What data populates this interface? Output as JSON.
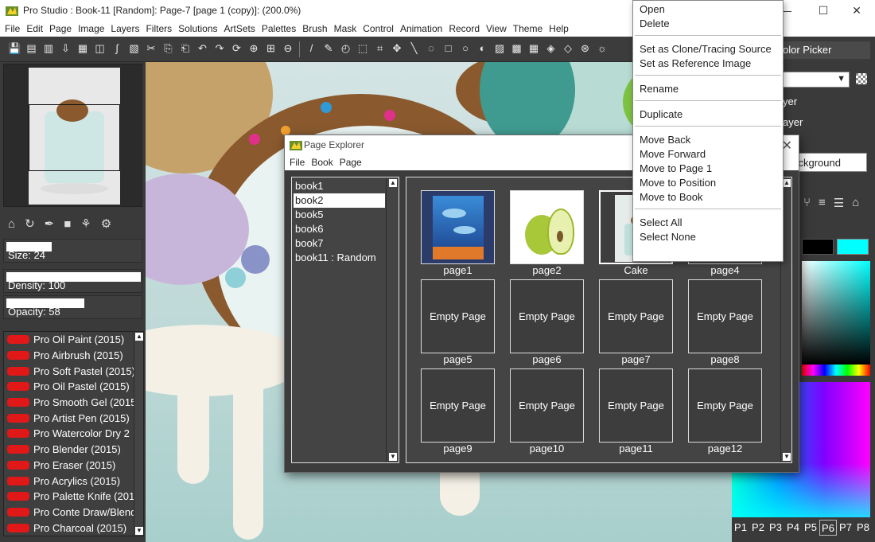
{
  "window": {
    "title": "Pro Studio : Book-11 [Random]: Page-7 [page 1 (copy)]: (200.0%)",
    "minimize": "—",
    "maximize": "☐",
    "close": "✕"
  },
  "menubar": [
    "File",
    "Edit",
    "Page",
    "Image",
    "Layers",
    "Filters",
    "Solutions",
    "ArtSets",
    "Palettes",
    "Brush",
    "Mask",
    "Control",
    "Animation",
    "Record",
    "View",
    "Theme",
    "Help"
  ],
  "toolbar": {
    "icons": [
      "save-icon",
      "save-as-icon",
      "export-icon",
      "import-icon",
      "new-page-icon",
      "gel-icon",
      "wand-icon",
      "clipboard-icon",
      "scissors-icon",
      "copy-icon",
      "paste-icon",
      "undo-icon",
      "redo-icon",
      "rotate-icon",
      "zoom-in-icon",
      "fit-icon",
      "zoom-out-icon",
      "brush-tool-icon",
      "eyedropper-icon",
      "bucket-icon",
      "select-rect-icon",
      "crop-icon",
      "move-icon",
      "line-icon",
      "lasso-icon",
      "rect-shape-icon",
      "ellipse-shape-icon",
      "blend-icon",
      "gradient-icon",
      "pattern-icon",
      "texture-icon",
      "mesh-icon",
      "emboss-icon",
      "clone-icon",
      "smudge-icon"
    ]
  },
  "left_panel": {
    "brush_tools": [
      "stamp-icon",
      "refresh-icon",
      "pen-tool-icon",
      "square-tool-icon",
      "layers-tool-icon",
      "settings-icon"
    ],
    "size_label": "Size: 24",
    "size_level": 0.34,
    "density_label": "Density: 100",
    "density_level": 1.0,
    "opacity_label": "Opacity: 58",
    "opacity_level": 0.58,
    "brushes": [
      "Pro Oil Paint (2015)",
      "Pro Airbrush (2015)",
      "Pro Soft Pastel (2015)",
      "Pro Oil Pastel (2015)",
      "Pro Smooth Gel (2015",
      "Pro Artist Pen (2015)",
      "Pro Watercolor Dry 2",
      "Pro Blender (2015)",
      "Pro Eraser (2015)",
      "Pro Acrylics (2015)",
      "Pro Palette Knife (201",
      "Pro Conte Draw/Blend",
      "Pro Charcoal (2015)"
    ]
  },
  "right_panel": {
    "color_picker_title": "olor Picker",
    "layer_rows": [
      "yer",
      "ayer",
      "yer"
    ],
    "layer_name_input": "background",
    "secondary_color": "#000000",
    "primary_color": "#00ffff",
    "palette_tabs": [
      "P1",
      "P2",
      "P3",
      "P4",
      "P5",
      "P6",
      "P7",
      "P8"
    ],
    "active_palette_tab": "P6"
  },
  "page_explorer": {
    "title": "Page Explorer",
    "menu": [
      "File",
      "Book",
      "Page"
    ],
    "books": [
      "book1",
      "book2",
      "book5",
      "book6",
      "book7",
      "book11 : Random"
    ],
    "selected_book": "book2",
    "pages": [
      {
        "label": "page1",
        "thumb_text": "",
        "thumb_kind": "dolphins"
      },
      {
        "label": "page2",
        "thumb_text": "",
        "thumb_kind": "pear"
      },
      {
        "label": "Cake",
        "thumb_text": "",
        "thumb_kind": "cake"
      },
      {
        "label": "page4",
        "thumb_text": "",
        "thumb_kind": "hidden"
      },
      {
        "label": "page5",
        "thumb_text": "Empty Page",
        "thumb_kind": "empty"
      },
      {
        "label": "page6",
        "thumb_text": "Empty Page",
        "thumb_kind": "empty"
      },
      {
        "label": "page7",
        "thumb_text": "Empty Page",
        "thumb_kind": "empty"
      },
      {
        "label": "page8",
        "thumb_text": "Empty Page",
        "thumb_kind": "empty"
      },
      {
        "label": "page9",
        "thumb_text": "Empty Page",
        "thumb_kind": "empty"
      },
      {
        "label": "page10",
        "thumb_text": "Empty Page",
        "thumb_kind": "empty"
      },
      {
        "label": "page11",
        "thumb_text": "Empty Page",
        "thumb_kind": "empty"
      },
      {
        "label": "page12",
        "thumb_text": "Empty Page",
        "thumb_kind": "empty"
      }
    ]
  },
  "context_menu": {
    "groups": [
      [
        "Open",
        "Delete"
      ],
      [
        "Set as Clone/Tracing Source",
        "Set as Reference Image"
      ],
      [
        "Rename"
      ],
      [
        "Duplicate"
      ],
      [
        "Move Back",
        "Move Forward",
        "Move to Page 1",
        "Move to Position",
        "Move to Book"
      ],
      [
        "Select All",
        "Select None"
      ]
    ]
  }
}
